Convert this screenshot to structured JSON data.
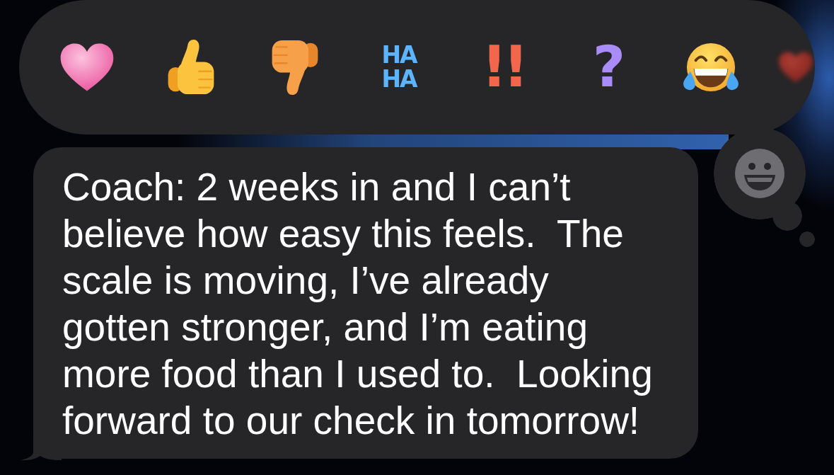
{
  "reaction_bar": {
    "reactions": [
      {
        "kind": "heart"
      },
      {
        "kind": "thumbs_up"
      },
      {
        "kind": "thumbs_down"
      },
      {
        "kind": "haha",
        "lines": [
          "HA",
          "HA"
        ]
      },
      {
        "kind": "emphasize",
        "text": "!!"
      },
      {
        "kind": "question",
        "text": "?"
      },
      {
        "kind": "laugh"
      },
      {
        "kind": "heart_cut"
      }
    ]
  },
  "message": {
    "text": "Coach: 2 weeks in and I can’t\nbelieve how easy this feels.  The\nscale is moving, I’ve already\ngotten stronger, and I’m eating\nmore food than I used to.  Looking\nforward to our check in tomorrow!"
  }
}
